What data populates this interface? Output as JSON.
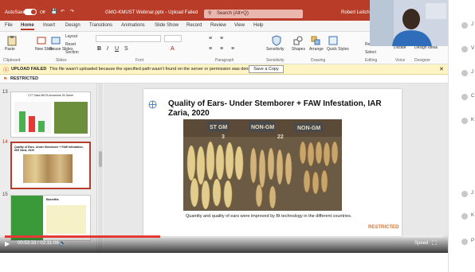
{
  "titlebar": {
    "autosave": "AutoSave",
    "toggle": "Off",
    "filename": "GMO-KMUST Webinar.pptx - Upload Failed",
    "search": "Search (Alt+Q)",
    "user": "Robert Leitch"
  },
  "menu": [
    "File",
    "Home",
    "Insert",
    "Design",
    "Transitions",
    "Animations",
    "Slide Show",
    "Record",
    "Review",
    "View",
    "Help"
  ],
  "ribbon": {
    "paste": "Paste",
    "new_slide": "New Slide",
    "reuse_slides": "Reuse Slides",
    "layout": "Layout",
    "reset": "Reset",
    "section": "Section",
    "sensitivity": "Sensitivity",
    "shapes": "Shapes",
    "arrange": "Arrange",
    "quick_styles": "Quick Styles",
    "replace": "Replace",
    "select": "Select",
    "dictate": "Dictate",
    "design_ideas": "Design Ideas",
    "groups": [
      "Clipboard",
      "Slides",
      "Font",
      "Paragraph",
      "Sensitivity",
      "Drawing",
      "Editing",
      "Voice",
      "Designer"
    ]
  },
  "infobar": {
    "label": "UPLOAD FAILED",
    "message": "This file wasn't uploaded because the specified path wasn't found on the server or permission was denied.",
    "button": "Save a Copy"
  },
  "restricted_label": "RESTRICTED",
  "thumbnails": [
    {
      "num": "13",
      "title": "CY7 Data MKTA Arrowvine 90 Same"
    },
    {
      "num": "14",
      "title": "Quality of Ears- Under Stemborer + FAW Infestation, IAR Zaria, 2020"
    },
    {
      "num": "15",
      "title": "Benefits"
    }
  ],
  "slide": {
    "title": "Quality of Ears- Under Stemborer + FAW Infestation, IAR Zaria, 2020",
    "caption": "Quantity and quality of ears were improved by Bt technology in the different countries.",
    "restricted": "RESTRICTED",
    "photo_labels": [
      "ST GM",
      "NON-GM",
      "NON-GM",
      "3",
      "22"
    ]
  },
  "player": {
    "time": "00:53:33 / 02:31:06",
    "speed": "Speed",
    "progress": 0.354
  },
  "sidebar_chars": [
    "J",
    "V",
    "J",
    "C",
    "K",
    "J",
    "K",
    "P"
  ]
}
